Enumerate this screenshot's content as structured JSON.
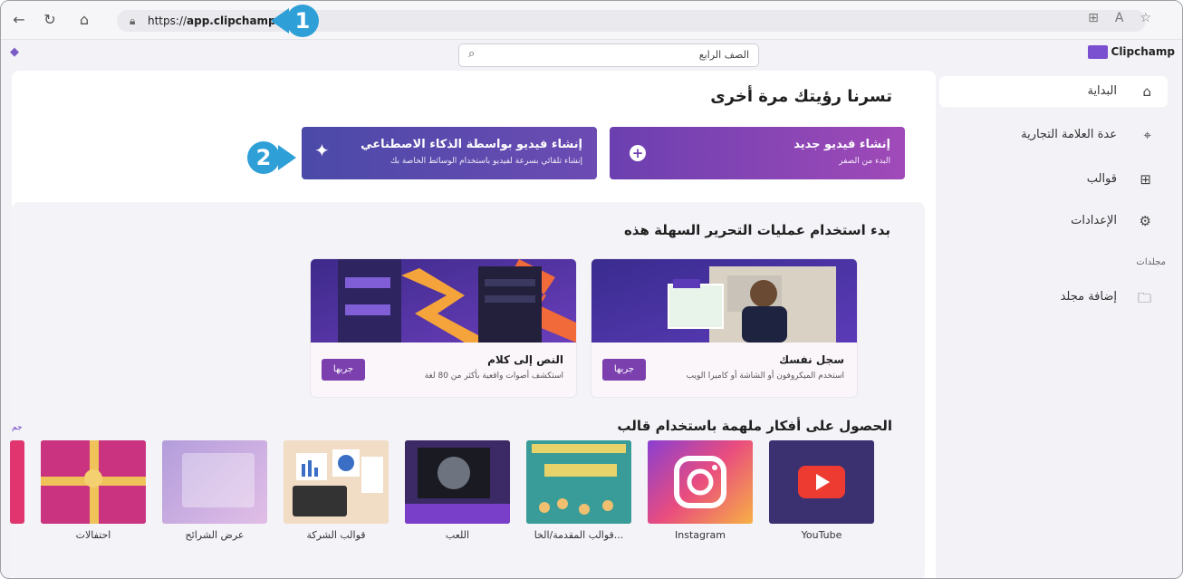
{
  "browser": {
    "url_prefix": "https://",
    "url_host": "app.clipchamp.com",
    "back_icon": "arrow-left-icon",
    "refresh_icon": "refresh-icon",
    "home_icon": "home-icon"
  },
  "badges": [
    "1",
    "2"
  ],
  "header": {
    "search_placeholder": "الصف الرابع",
    "logo_text": "Clipchamp"
  },
  "sidebar": {
    "items": [
      {
        "label": "البداية",
        "icon": "home-icon"
      },
      {
        "label": "عدة العلامة التجارية",
        "icon": "brand-kit-icon"
      },
      {
        "label": "قوالب",
        "icon": "templates-icon"
      },
      {
        "label": "الإعدادات",
        "icon": "settings-icon"
      }
    ],
    "section_label": "مجلدات",
    "add_folder": {
      "label": "إضافة مجلد",
      "icon": "folder-add-icon"
    }
  },
  "main": {
    "welcome": "تسرنا رؤيتك مرة أخرى",
    "cta_new": {
      "title": "إنشاء فيديو جديد",
      "subtitle": "البدء من الصفر"
    },
    "cta_ai": {
      "title": "إنشاء فيديو بواسطة الذكاء الاصطناعي",
      "subtitle": "إنشاء تلقائي بسرعة لفيديو باستخدام الوسائط الخاصة بك"
    },
    "easy_title": "بدء استخدام عمليات التحرير السهلة هذه",
    "feature_cards": [
      {
        "title": "سجل نفسك",
        "desc": "استخدم الميكروفون أو الشاشة أو كاميرا الويب",
        "button": "جربها"
      },
      {
        "title": "النص إلى كلام",
        "desc": "استكشف أصوات واقعية بأكثر من 80 لغة",
        "button": "جربها"
      }
    ],
    "templates_title": "الحصول على أفكار ملهمة باستخدام قالب",
    "templates": [
      "YouTube",
      "Instagram",
      "قوالب المقدمة/الخا...",
      "اللعب",
      "قوالب الشركة",
      "عرض الشرائح",
      "احتفالات"
    ],
    "partial_label": "جم"
  },
  "colors": {
    "accent": "#7b3fae",
    "badge": "#2f9fd7",
    "cta_new": "#8d45b4",
    "cta_ai": "#5a49a6"
  }
}
